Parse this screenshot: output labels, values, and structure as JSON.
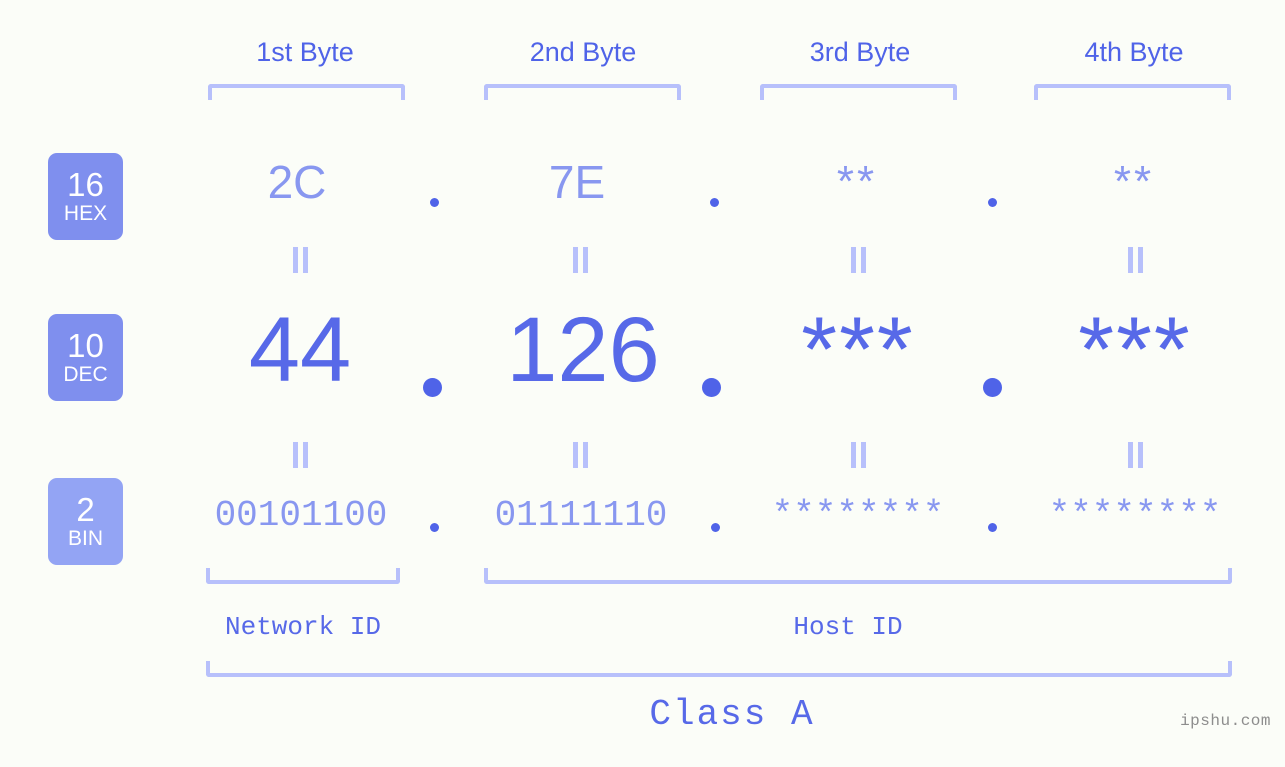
{
  "background_color": "#fbfdf8",
  "accent_colors": {
    "strong_blue": "#4f63e8",
    "dec_blue": "#5769e8",
    "light_periwinkle": "#8897f0",
    "bracket": "#b7c0fb",
    "badge_hex": "#7f8fee",
    "badge_dec": "#7f8fee",
    "badge_bin": "#93a4f4",
    "watermark": "#8d8d8d"
  },
  "byte_headers": [
    {
      "label": "1st Byte"
    },
    {
      "label": "2nd Byte"
    },
    {
      "label": "3rd Byte"
    },
    {
      "label": "4th Byte"
    }
  ],
  "base_badges": [
    {
      "number": "16",
      "base": "HEX"
    },
    {
      "number": "10",
      "base": "DEC"
    },
    {
      "number": "2",
      "base": "BIN"
    }
  ],
  "rows": {
    "hex": {
      "values": [
        "2C",
        "7E",
        "**",
        "**"
      ]
    },
    "dec": {
      "values": [
        "44",
        "126",
        "***",
        "***"
      ]
    },
    "bin": {
      "values": [
        "00101100",
        "01111110",
        "********",
        "********"
      ]
    }
  },
  "separator": ".",
  "equals_symbol": "=",
  "segments": {
    "network_id": "Network ID",
    "host_id": "Host ID"
  },
  "class_label": "Class A",
  "watermark": "ipshu.com"
}
